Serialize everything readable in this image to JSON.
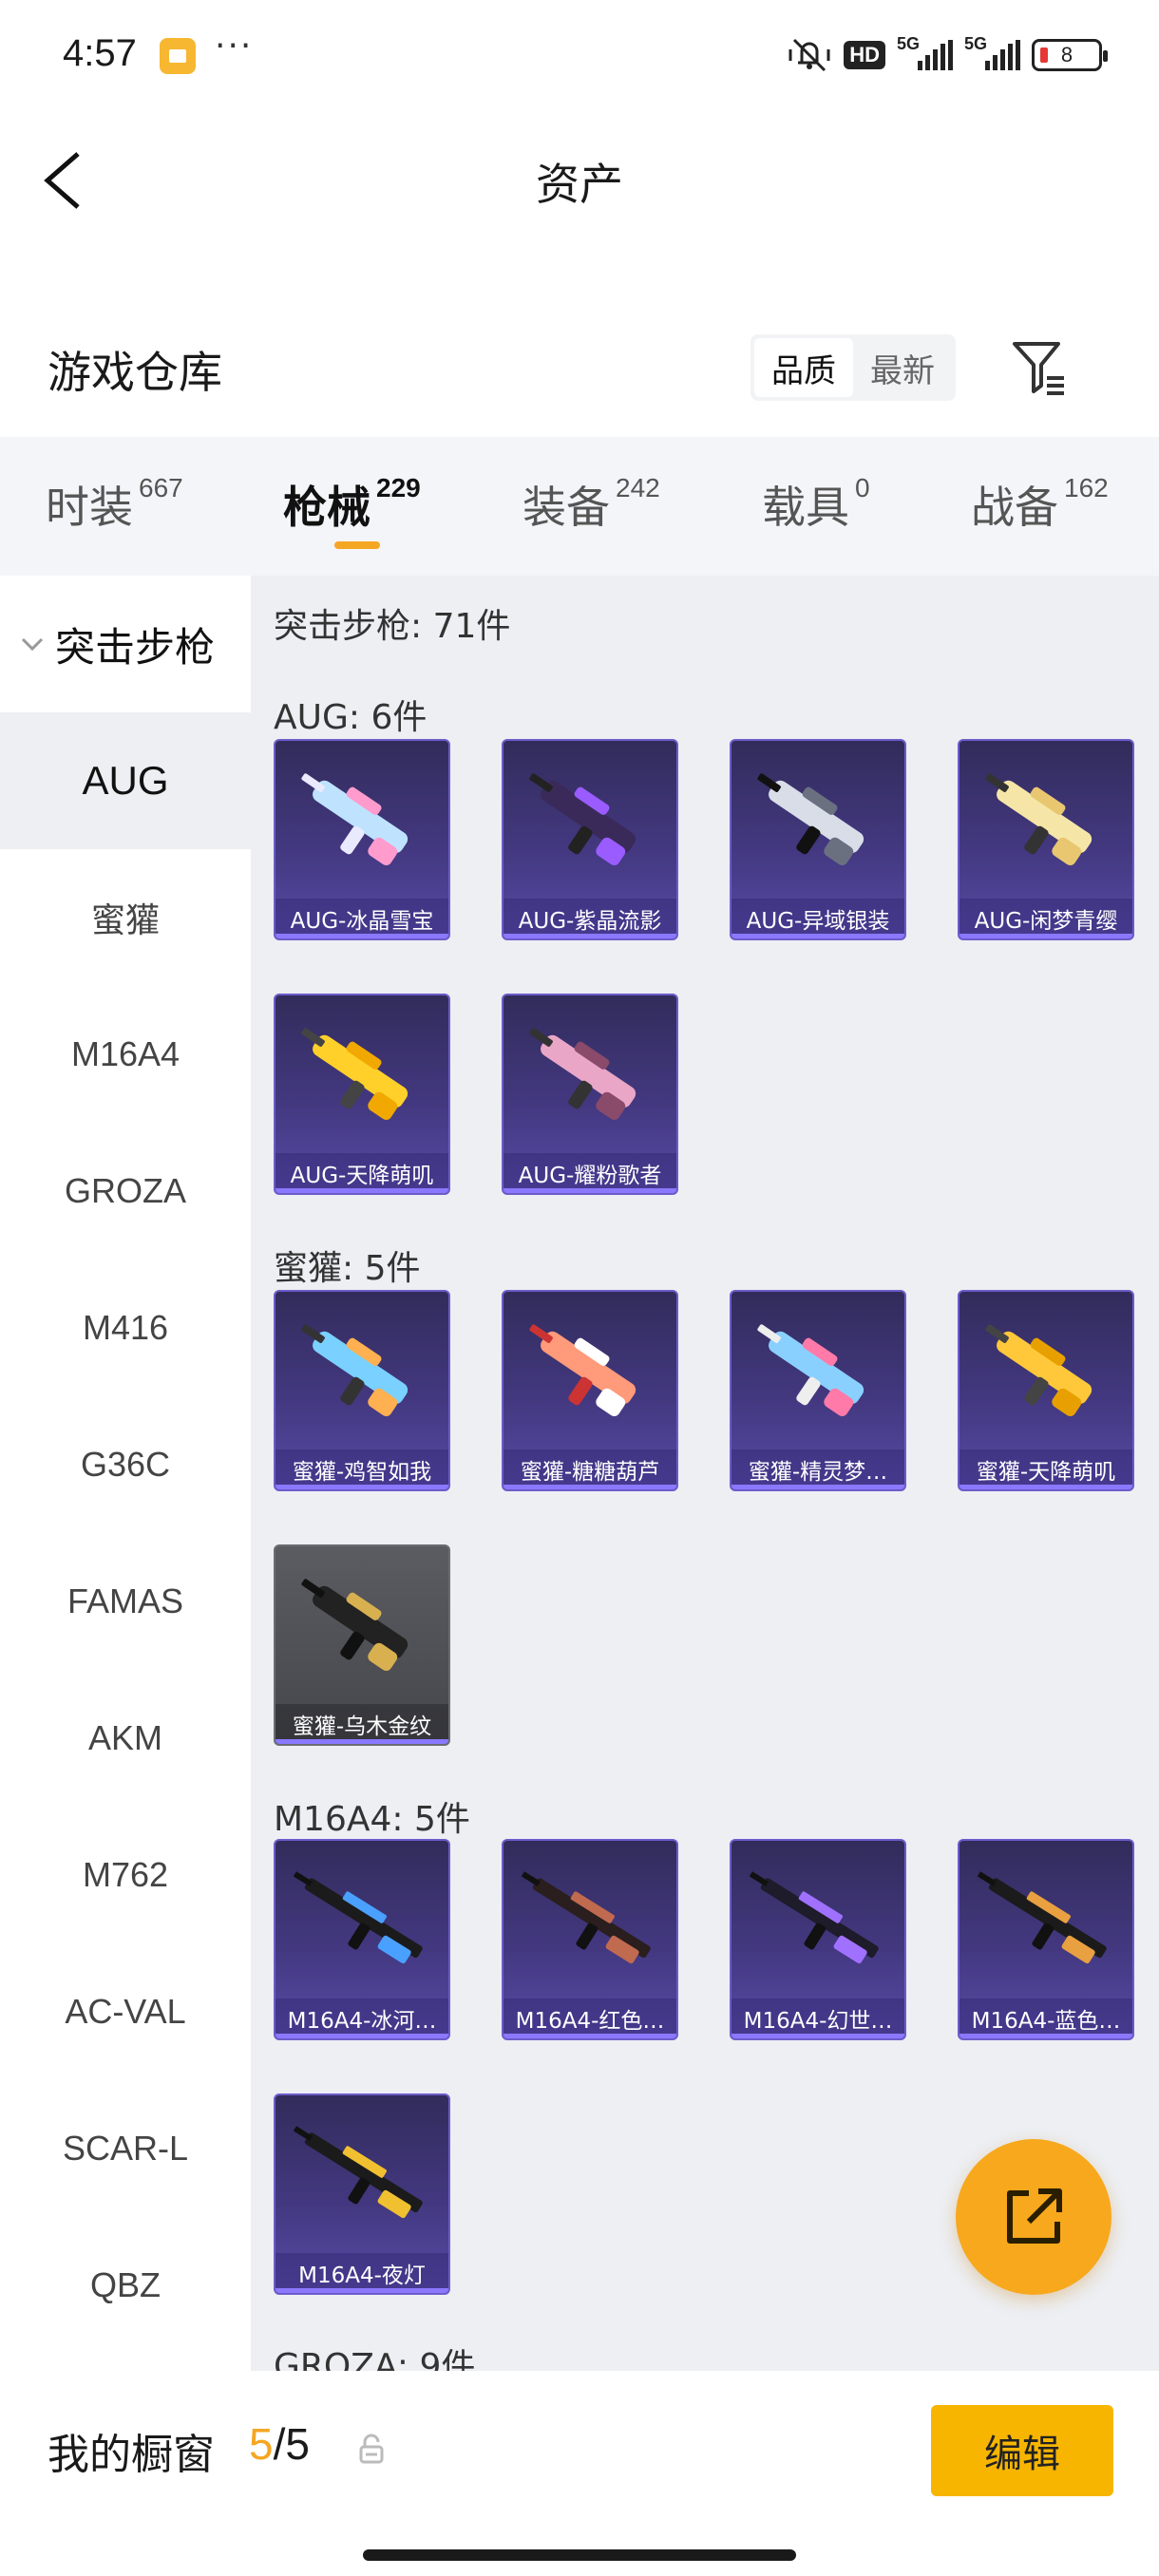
{
  "status": {
    "time": "4:57",
    "battery": "8",
    "net1": "5G",
    "net2": "5G",
    "hd": "HD"
  },
  "header": {
    "title": "资产"
  },
  "section": {
    "title": "游戏仓库",
    "sort_options": [
      "品质",
      "最新"
    ],
    "active_sort": 0
  },
  "tabs": [
    {
      "name": "时装",
      "count": "667"
    },
    {
      "name": "枪械",
      "count": "229",
      "active": true
    },
    {
      "name": "装备",
      "count": "242"
    },
    {
      "name": "载具",
      "count": "0"
    },
    {
      "name": "战备",
      "count": "162"
    }
  ],
  "sidenav": {
    "category": "突击步枪",
    "items": [
      "AUG",
      "蜜獾",
      "M16A4",
      "GROZA",
      "M416",
      "G36C",
      "FAMAS",
      "AKM",
      "M762",
      "AC-VAL",
      "SCAR-L",
      "QBZ"
    ],
    "active": "AUG"
  },
  "content": {
    "category_header": "突击步枪: 71件",
    "groups": [
      {
        "header": "AUG: 6件",
        "items": [
          "AUG-冰晶雪宝",
          "AUG-紫晶流影",
          "AUG-异域银装",
          "AUG-闲梦青缨",
          "AUG-天降萌叽",
          "AUG-耀粉歌者"
        ]
      },
      {
        "header": "蜜獾: 5件",
        "items": [
          "蜜獾-鸡智如我",
          "蜜獾-糖糖葫芦",
          "蜜獾-精灵梦…",
          "蜜獾-天降萌叽",
          "蜜獾-乌木金纹"
        ]
      },
      {
        "header": "M16A4: 5件",
        "items": [
          "M16A4-冰河…",
          "M16A4-红色…",
          "M16A4-幻世…",
          "M16A4-蓝色…",
          "M16A4-夜灯"
        ]
      },
      {
        "header": "GROZA: 9件"
      }
    ]
  },
  "bottom": {
    "showcase_label": "我的橱窗",
    "showcase_current": "5",
    "showcase_total": "/5",
    "edit_label": "编辑"
  },
  "colors": {
    "accent": "#f5a623",
    "card_purple": "#433880",
    "card_grey": "#4e4f55"
  },
  "icons": {
    "back": "chevron-left-icon",
    "filter": "filter-icon",
    "fab": "share-external-icon",
    "lock": "lock-icon"
  }
}
